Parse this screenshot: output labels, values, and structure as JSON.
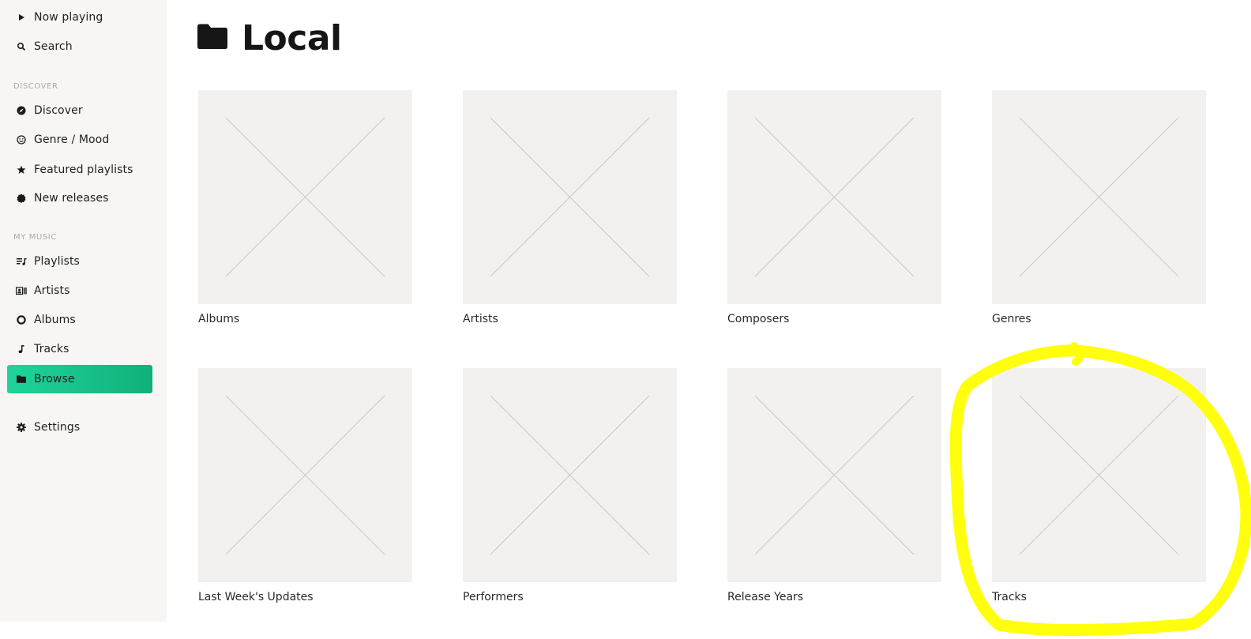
{
  "sidebar": {
    "top_items": [
      {
        "label": "Now playing",
        "icon": "play-icon"
      },
      {
        "label": "Search",
        "icon": "search-icon"
      }
    ],
    "discover_label": "DISCOVER",
    "discover_items": [
      {
        "label": "Discover",
        "icon": "compass-icon"
      },
      {
        "label": "Genre / Mood",
        "icon": "smiley-icon"
      },
      {
        "label": "Featured playlists",
        "icon": "star-icon"
      },
      {
        "label": "New releases",
        "icon": "new-badge-icon"
      }
    ],
    "my_music_label": "MY MUSIC",
    "my_music_items": [
      {
        "label": "Playlists",
        "icon": "playlist-icon"
      },
      {
        "label": "Artists",
        "icon": "artist-card-icon"
      },
      {
        "label": "Albums",
        "icon": "album-icon"
      },
      {
        "label": "Tracks",
        "icon": "music-note-icon"
      },
      {
        "label": "Browse",
        "icon": "folder-icon",
        "active": true
      }
    ],
    "settings": {
      "label": "Settings",
      "icon": "gear-icon"
    }
  },
  "main": {
    "title": "Local",
    "title_icon": "folder-icon",
    "tiles": [
      {
        "label": "Albums"
      },
      {
        "label": "Artists"
      },
      {
        "label": "Composers"
      },
      {
        "label": "Genres"
      },
      {
        "label": "Last Week's Updates"
      },
      {
        "label": "Performers"
      },
      {
        "label": "Release Years"
      },
      {
        "label": "Tracks"
      }
    ]
  },
  "colors": {
    "accent": "#16c98a",
    "sidebar_bg": "#f7f6f5",
    "placeholder_bg": "#f2f1f0",
    "annotation": "#ffff00"
  },
  "annotation": {
    "shape": "hand-drawn circle",
    "target": "Tracks"
  }
}
